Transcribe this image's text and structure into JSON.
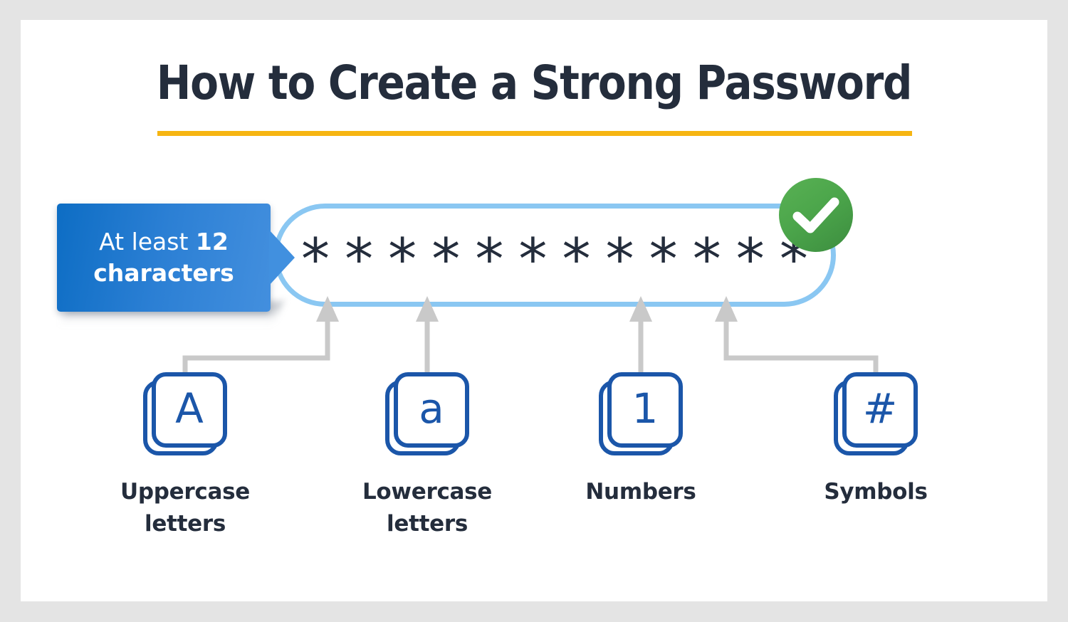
{
  "page": {
    "background_color": "#e4e4e4",
    "card_color": "#ffffff"
  },
  "header": {
    "title": "How to Create a Strong Password",
    "rule_color": "#f6b512"
  },
  "callout": {
    "line1_prefix": "At least ",
    "line1_strong": "12",
    "line2": "characters",
    "color_start": "#0d6dc4",
    "color_end": "#438fde"
  },
  "password_field": {
    "mask_character": "*",
    "mask_count": 12,
    "masked_value": "************",
    "border_color": "#8ac7f2",
    "text_color": "#242d3c"
  },
  "status": {
    "icon": "check-circle-icon",
    "color": "#4ca64b",
    "meaning": "valid"
  },
  "requirements": [
    {
      "key_glyph": "A",
      "key_icon": "keycap-uppercase-icon",
      "label_line1": "Uppercase",
      "label_line2": "letters",
      "connector": "elbow-right"
    },
    {
      "key_glyph": "a",
      "key_icon": "keycap-lowercase-icon",
      "label_line1": "Lowercase",
      "label_line2": "letters",
      "connector": "straight"
    },
    {
      "key_glyph": "1",
      "key_icon": "keycap-number-icon",
      "label_line1": "Numbers",
      "label_line2": "",
      "connector": "straight"
    },
    {
      "key_glyph": "#",
      "key_icon": "keycap-symbol-icon",
      "label_line1": "Symbols",
      "label_line2": "",
      "connector": "elbow-left"
    }
  ],
  "colors": {
    "key_blue": "#1b56a9",
    "text_navy": "#242d3c",
    "connector_gray": "#c9c9c9"
  }
}
